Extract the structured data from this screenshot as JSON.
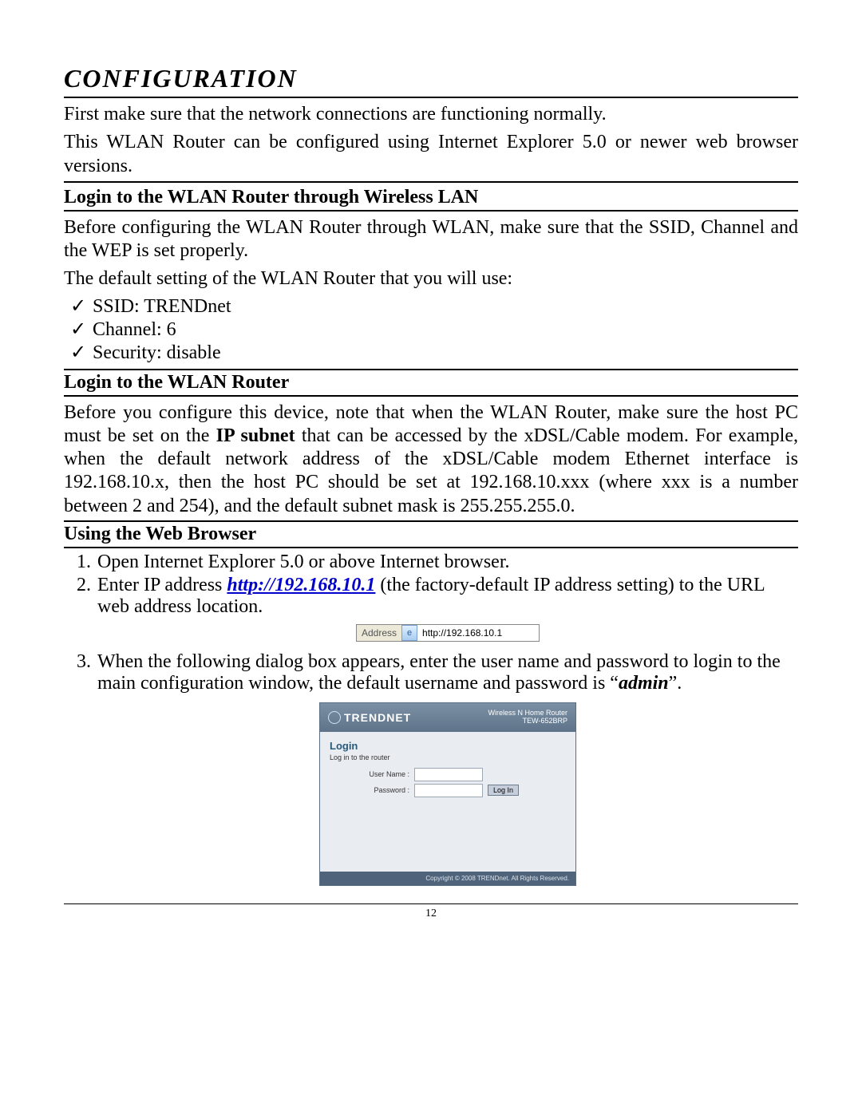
{
  "title": "CONFIGURATION",
  "intro_line1": "First make sure that the network connections are functioning normally.",
  "intro_line2": "This WLAN Router can be configured using Internet Explorer 5.0 or newer web browser versions.",
  "sec1_head": "Login to the WLAN Router through Wireless LAN",
  "sec1_p1": "Before configuring the WLAN Router through WLAN, make sure that the SSID, Channel and the WEP is set properly.",
  "sec1_p2": "The default setting of the WLAN Router that you will use:",
  "sec1_items": {
    "a": "SSID: TRENDnet",
    "b": "Channel: 6",
    "c": "Security: disable"
  },
  "sec2_head": "Login to the WLAN Router",
  "sec2_p_a": "Before you configure this device, note that when the WLAN Router, make sure the host PC must be set on the ",
  "sec2_ip_subnet": "IP subnet",
  "sec2_p_b": " that can be accessed by the xDSL/Cable modem. For example, when the default network address of the xDSL/Cable modem Ethernet interface is 192.168.10.x, then the host PC should be set at 192.168.10.xxx (where xxx is a number between 2 and 254), and the default subnet mask is 255.255.255.0.",
  "sec3_head": "Using the Web Browser",
  "steps": {
    "s1": "Open Internet Explorer 5.0 or above Internet browser.",
    "s2a": "Enter IP address ",
    "s2_link": "http://192.168.10.1",
    "s2b": " (the factory-default IP address setting) to the URL web address location.",
    "s3a": "When the following dialog box appears, enter the user name and password to login to the main configuration window, the default username and password is “",
    "s3_admin": "admin",
    "s3b": "”."
  },
  "addr_fig": {
    "label": "Address",
    "url": "http://192.168.10.1"
  },
  "login_fig": {
    "brand": "TRENDNET",
    "top_right_l1": "Wireless N Home Router",
    "top_right_l2": "TEW-652BRP",
    "heading": "Login",
    "sub": "Log in to the router",
    "user_label": "User Name :",
    "pass_label": "Password :",
    "btn": "Log In",
    "footer": "Copyright © 2008 TRENDnet. All Rights Reserved."
  },
  "page_number": "12"
}
